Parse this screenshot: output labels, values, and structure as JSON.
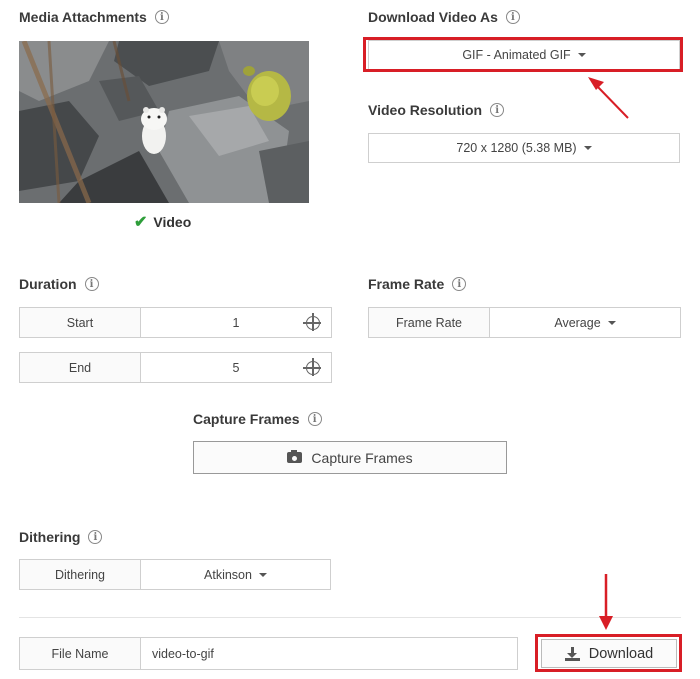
{
  "media": {
    "heading": "Media Attachments",
    "caption": "Video"
  },
  "download_as": {
    "heading": "Download Video As",
    "selected": "GIF - Animated GIF"
  },
  "resolution": {
    "heading": "Video Resolution",
    "selected": "720 x 1280 (5.38 MB)"
  },
  "duration": {
    "heading": "Duration",
    "start_label": "Start",
    "start_value": "1",
    "end_label": "End",
    "end_value": "5"
  },
  "frame_rate": {
    "heading": "Frame Rate",
    "label": "Frame Rate",
    "selected": "Average"
  },
  "capture": {
    "heading": "Capture Frames",
    "button_label": "Capture Frames"
  },
  "dithering": {
    "heading": "Dithering",
    "label": "Dithering",
    "selected": "Atkinson"
  },
  "file": {
    "label": "File Name",
    "value": "video-to-gif"
  },
  "download_button": {
    "label": "Download"
  },
  "icons": {
    "info": "info-circle-icon",
    "check": "checkmark-icon",
    "crosshair": "crosshair-icon",
    "camera": "camera-icon",
    "download": "download-icon"
  },
  "colors": {
    "highlight": "#d81e26",
    "check": "#2e9e3a"
  }
}
